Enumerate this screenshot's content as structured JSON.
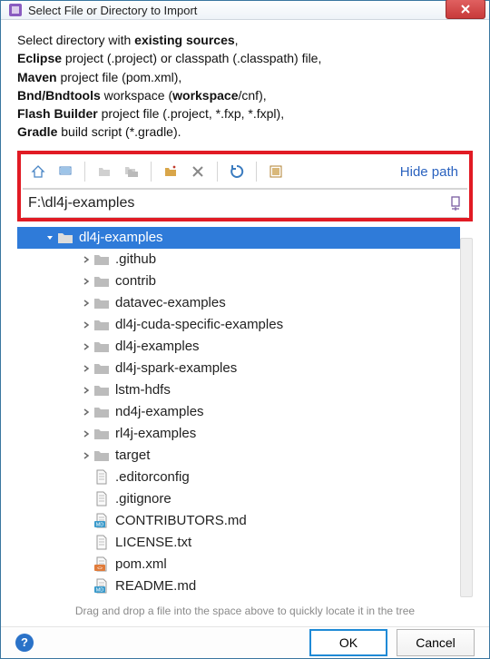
{
  "titlebar": {
    "title": "Select File or Directory to Import"
  },
  "instructions": {
    "line1_prefix": "Select directory with ",
    "line1_bold": "existing sources",
    "line1_suffix": ",",
    "line2_bold": "Eclipse",
    "line2_rest": " project (.project) or classpath (.classpath) file,",
    "line3_bold": "Maven",
    "line3_rest": " project file (pom.xml),",
    "line4_bold": "Bnd/Bndtools",
    "line4_rest": " workspace (",
    "line4_bold2": "workspace",
    "line4_rest2": "/cnf),",
    "line5_bold": "Flash Builder",
    "line5_rest": " project file (.project, *.fxp, *.fxpl),",
    "line6_bold": "Gradle",
    "line6_rest": " build script (*.gradle)."
  },
  "toolbar": {
    "hide_path": "Hide path",
    "icons": {
      "home": "home-icon",
      "desktop": "desktop-icon",
      "folder1": "folder-icon",
      "folder2": "folder-multi-icon",
      "newfolder": "new-folder-icon",
      "delete": "delete-icon",
      "refresh": "refresh-icon",
      "thumbnails": "thumbnails-icon"
    }
  },
  "path": {
    "value": "F:\\dl4j-examples"
  },
  "tree": {
    "root": {
      "name": "dl4j-examples",
      "type": "folder",
      "expanded": true,
      "selected": true,
      "depth": 0
    },
    "children": [
      {
        "name": ".github",
        "type": "folder",
        "expanded": false,
        "depth": 1
      },
      {
        "name": "contrib",
        "type": "folder",
        "expanded": false,
        "depth": 1
      },
      {
        "name": "datavec-examples",
        "type": "folder",
        "expanded": false,
        "depth": 1
      },
      {
        "name": "dl4j-cuda-specific-examples",
        "type": "folder",
        "expanded": false,
        "depth": 1
      },
      {
        "name": "dl4j-examples",
        "type": "folder",
        "expanded": false,
        "depth": 1
      },
      {
        "name": "dl4j-spark-examples",
        "type": "folder",
        "expanded": false,
        "depth": 1
      },
      {
        "name": "lstm-hdfs",
        "type": "folder",
        "expanded": false,
        "depth": 1
      },
      {
        "name": "nd4j-examples",
        "type": "folder",
        "expanded": false,
        "depth": 1
      },
      {
        "name": "rl4j-examples",
        "type": "folder",
        "expanded": false,
        "depth": 1
      },
      {
        "name": "target",
        "type": "folder",
        "expanded": false,
        "depth": 1
      },
      {
        "name": ".editorconfig",
        "type": "file-plain",
        "depth": 1
      },
      {
        "name": ".gitignore",
        "type": "file-plain",
        "depth": 1
      },
      {
        "name": "CONTRIBUTORS.md",
        "type": "file-md",
        "depth": 1
      },
      {
        "name": "LICENSE.txt",
        "type": "file-plain",
        "depth": 1
      },
      {
        "name": "pom.xml",
        "type": "file-xml",
        "depth": 1
      },
      {
        "name": "README.md",
        "type": "file-md",
        "depth": 1
      }
    ]
  },
  "hint": "Drag and drop a file into the space above to quickly locate it in the tree",
  "footer": {
    "ok": "OK",
    "cancel": "Cancel"
  }
}
